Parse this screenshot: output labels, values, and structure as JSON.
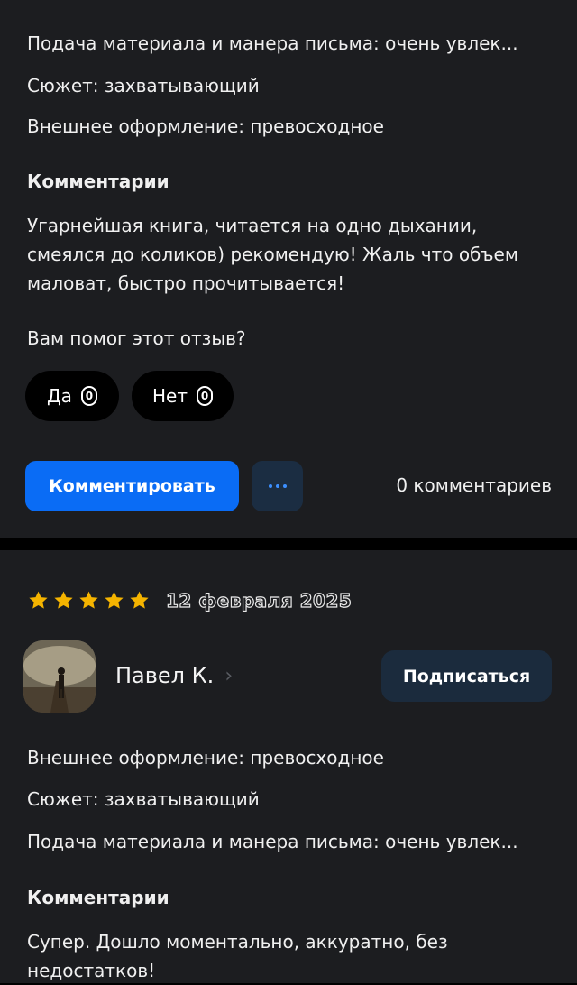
{
  "review1": {
    "criteria": [
      "Подача материала и манера письма: очень увлек...",
      "Сюжет: захватывающий",
      "Внешнее оформление: превосходное"
    ],
    "comments_heading": "Комментарии",
    "comment_text": "Угарнейшая книга, читается на одно дыхании, смеялся до коликов) рекомендую! Жаль что объем маловат, быстро прочитывается!",
    "helpful_question": "Вам помог этот отзыв?",
    "yes_label": "Да",
    "yes_count": "0",
    "no_label": "Нет",
    "no_count": "0",
    "comment_button": "Комментировать",
    "more_icon": "more-dots-icon",
    "comments_count": "0 комментариев"
  },
  "review2": {
    "rating": 5,
    "date": "12 февраля 2025",
    "author": "Павел К.",
    "subscribe_button": "Подписаться",
    "criteria": [
      "Внешнее оформление: превосходное",
      "Сюжет: захватывающий",
      "Подача материала и манера письма: очень увлек..."
    ],
    "comments_heading": "Комментарии",
    "comment_text": "Супер. Дошло моментально, аккуратно, без недостатков!"
  },
  "colors": {
    "card_bg": "#1c1d20",
    "separator": "#000000",
    "accent_blue": "#0a6cf5",
    "star": "#f5b400",
    "subscribe_bg": "#1b2b3d"
  }
}
